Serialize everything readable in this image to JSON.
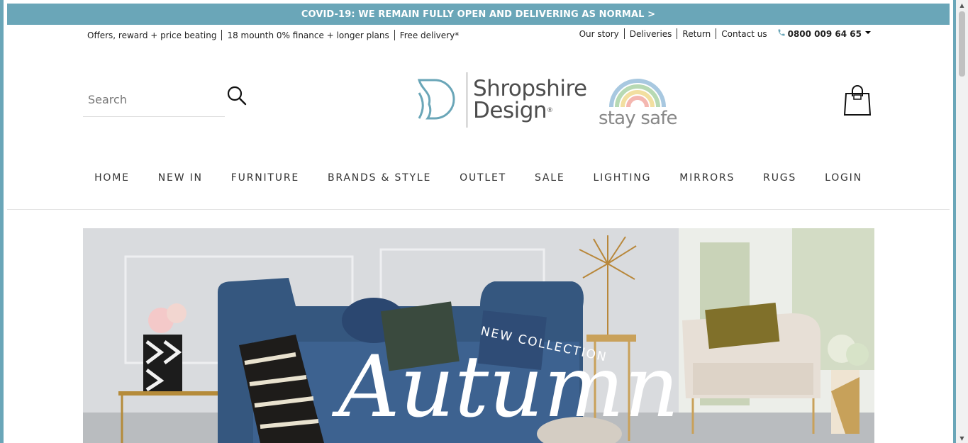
{
  "banner": {
    "text": "COVID-19: WE REMAIN FULLY OPEN AND DELIVERING AS NORMAL >"
  },
  "topbar": {
    "left": [
      "Offers, reward + price beating",
      "18 mounth 0% finance + longer plans",
      "Free delivery*"
    ],
    "right": [
      "Our story",
      "Deliveries",
      "Return",
      "Contact us"
    ],
    "phone": "0800 009 64 65"
  },
  "search": {
    "placeholder": "Search"
  },
  "logo": {
    "line1": "Shropshire",
    "line2": "Design"
  },
  "stay_safe": {
    "text": "stay safe"
  },
  "nav": [
    "HOME",
    "NEW IN",
    "FURNITURE",
    "BRANDS & STYLE",
    "OUTLET",
    "SALE",
    "LIGHTING",
    "MIRRORS",
    "RUGS",
    "LOGIN"
  ],
  "hero": {
    "overlay_small": "NEW COLLECTION",
    "overlay_script": "Autumn"
  },
  "colors": {
    "accent": "#6aa6b8",
    "sofa": "#35577f"
  },
  "icons": [
    "search-icon",
    "bag-icon",
    "phone-icon",
    "caret-down-icon"
  ]
}
